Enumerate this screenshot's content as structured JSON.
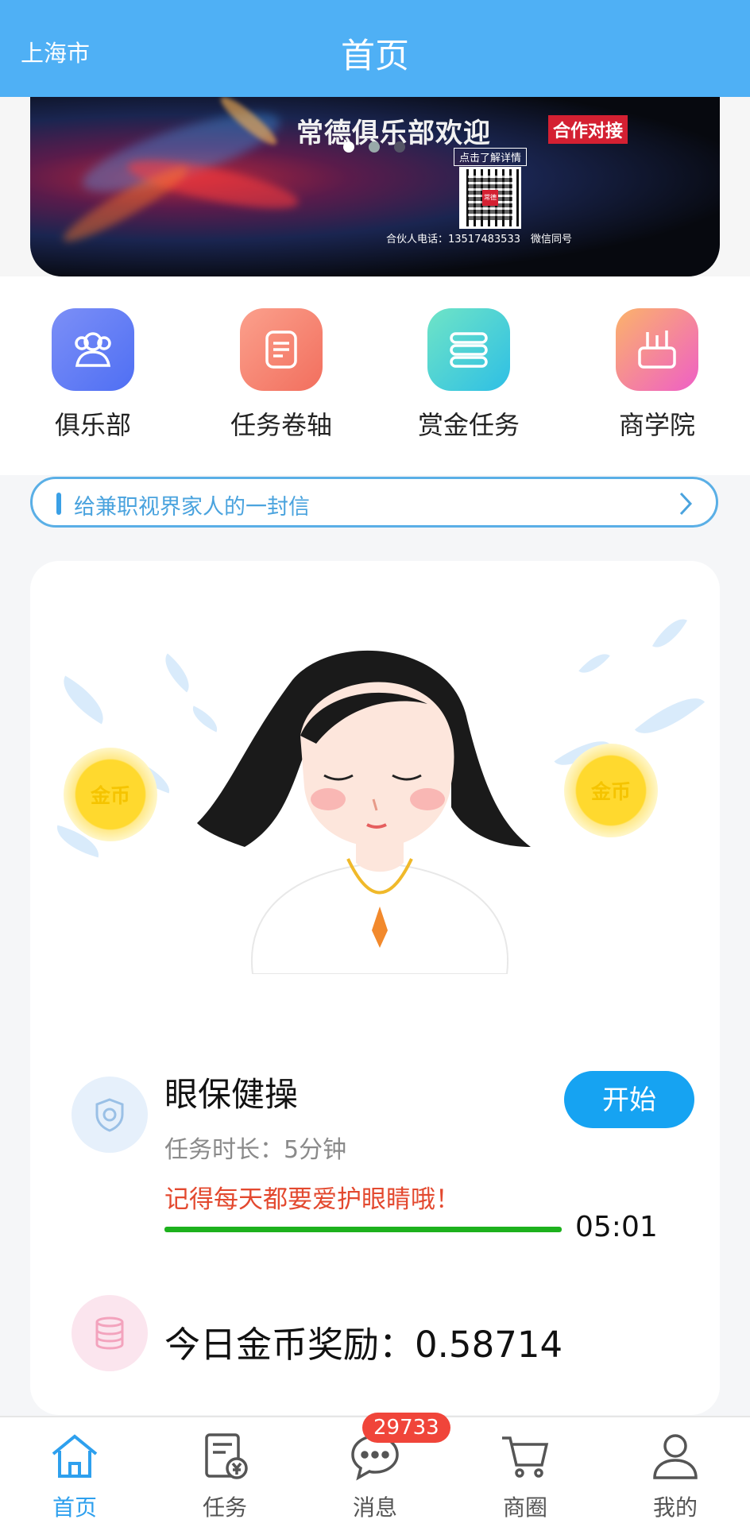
{
  "header": {
    "city": "上海市",
    "title": "首页"
  },
  "banner": {
    "title": "常德俱乐部欢迎",
    "tag": "合作对接",
    "detail_link": "点击了解详情",
    "qr_center": "常德",
    "phone_line": "合伙人电话：13517483533　微信同号",
    "slide_count": 3,
    "active_slide": 1
  },
  "quick_nav": [
    {
      "label": "俱乐部",
      "icon": "users-icon",
      "colors": [
        "#7c8ff7",
        "#4f6ff3"
      ]
    },
    {
      "label": "任务卷轴",
      "icon": "document-icon",
      "colors": [
        "#fba08c",
        "#f26f5e"
      ]
    },
    {
      "label": "赏金任务",
      "icon": "stack-icon",
      "colors": [
        "#6fe4c6",
        "#2ebfe5"
      ]
    },
    {
      "label": "商学院",
      "icon": "pen-holder-icon",
      "colors": [
        "#fbb36a",
        "#ef5fc6"
      ]
    }
  ],
  "notice": {
    "text": "给兼职视界家人的一封信"
  },
  "task": {
    "coin_left_label": "金币",
    "coin_right_label": "金币",
    "name": "眼保健操",
    "duration": "任务时长：5分钟",
    "tip": "记得每天都要爱护眼睛哦！",
    "progress": 1.0,
    "timer": "05:01",
    "start_label": "开始",
    "reward": "今日金币奖励：0.58714"
  },
  "tabbar": {
    "active": "home",
    "tabs": [
      {
        "key": "home",
        "label": "首页",
        "icon": "home-icon"
      },
      {
        "key": "task",
        "label": "任务",
        "icon": "task-doc-icon"
      },
      {
        "key": "message",
        "label": "消息",
        "icon": "chat-icon",
        "badge": "29733"
      },
      {
        "key": "mall",
        "label": "商圈",
        "icon": "cart-icon"
      },
      {
        "key": "mine",
        "label": "我的",
        "icon": "user-icon"
      }
    ]
  },
  "colors": {
    "primary": "#4fb0f5",
    "accent": "#16a3f2",
    "progress": "#1db11d",
    "tip": "#e3492f",
    "badge": "#f0453a"
  }
}
